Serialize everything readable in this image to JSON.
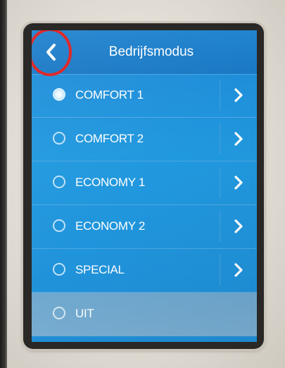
{
  "header": {
    "title": "Bedrijfsmodus",
    "back_icon": "chevron-left-icon"
  },
  "menu": {
    "items": [
      {
        "label": "COMFORT 1",
        "selected": true
      },
      {
        "label": "COMFORT 2",
        "selected": false
      },
      {
        "label": "ECONOMY 1",
        "selected": false
      },
      {
        "label": "ECONOMY 2",
        "selected": false
      },
      {
        "label": "SPECIAL",
        "selected": false
      },
      {
        "label": "UIT",
        "selected": false
      }
    ]
  },
  "colors": {
    "screen_blue": "#2199df",
    "highlight_ring": "#e01e1e",
    "text": "#ffffff"
  }
}
